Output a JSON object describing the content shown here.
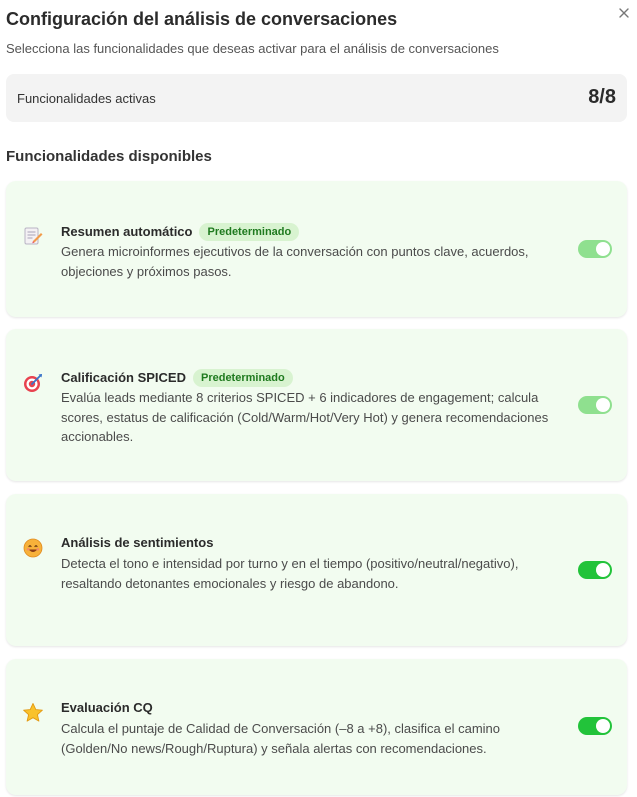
{
  "header": {
    "title": "Configuración del análisis de conversaciones",
    "subtitle": "Selecciona las funcionalidades que deseas activar para el análisis de conversaciones"
  },
  "active": {
    "label": "Funcionalidades activas",
    "count": "8/8"
  },
  "section_title": "Funcionalidades disponibles",
  "features": [
    {
      "name": "Resumen automático",
      "badge": "Predeterminado",
      "desc": "Genera microinformes ejecutivos de la conversación con puntos clave, acuerdos, objeciones y próximos pasos.",
      "icon": "memo-icon",
      "enabled": true,
      "locked": true
    },
    {
      "name": "Calificación SPICED",
      "badge": "Predeterminado",
      "desc": "Evalúa leads mediante 8 criterios SPICED + 6 indicadores de engagement; calcula scores, estatus de calificación (Cold/Warm/Hot/Very Hot) y genera recomendaciones accionables.",
      "icon": "target-icon",
      "enabled": true,
      "locked": true
    },
    {
      "name": "Análisis de sentimientos",
      "badge": "",
      "desc": "Detecta el tono e intensidad por turno y en el tiempo (positivo/neutral/negativo), resaltando detonantes emocionales y riesgo de abandono.",
      "icon": "smile-icon",
      "enabled": true,
      "locked": false
    },
    {
      "name": "Evaluación CQ",
      "badge": "",
      "desc": "Calcula el puntaje de Calidad de Conversación (–8 a +8), clasifica el camino (Golden/No news/Rough/Ruptura) y señala alertas con recomendaciones.",
      "icon": "star-icon",
      "enabled": true,
      "locked": false
    }
  ],
  "colors": {
    "card_bg": "#f2fcf0",
    "toggle_on": "#22c33a",
    "toggle_locked": "#8fe08f",
    "badge_bg": "#d8f3d0",
    "badge_text": "#1f7a1f"
  }
}
